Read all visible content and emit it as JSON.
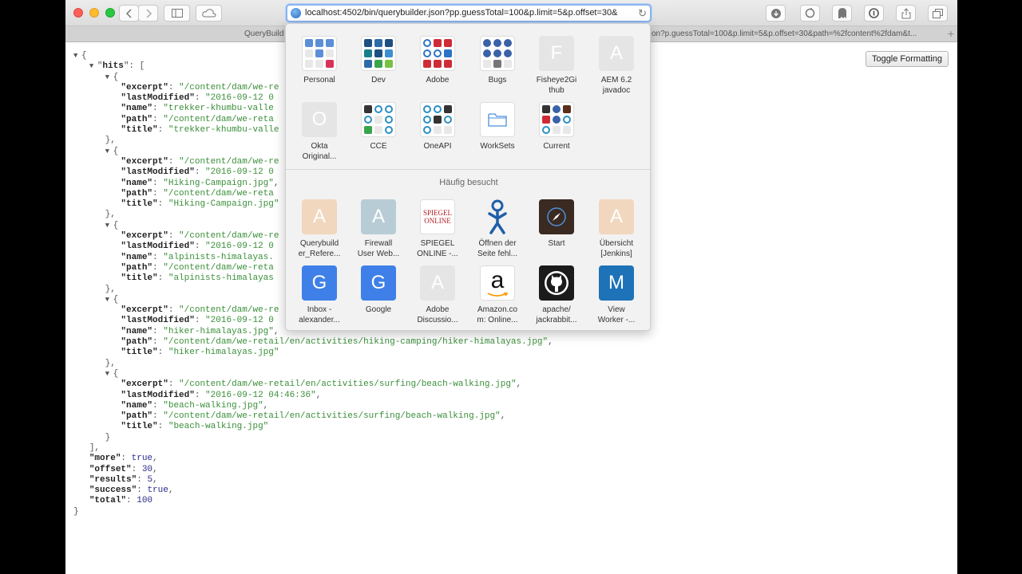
{
  "browser": {
    "url": "localhost:4502/bin/querybuilder.json?pp.guessTotal=100&p.limit=5&p.offset=30&",
    "tabs": [
      {
        "label": "QueryBuild"
      },
      {
        "label": "on?p.guessTotal=100&p.limit=5&p.offset=30&path=%2fcontent%2fdam&t..."
      }
    ],
    "toggle_button": "Toggle Formatting"
  },
  "favorites": [
    {
      "label": "Personal",
      "icon": "personal-folder-icon"
    },
    {
      "label": "Dev",
      "icon": "dev-folder-icon"
    },
    {
      "label": "Adobe",
      "icon": "adobe-folder-icon"
    },
    {
      "label": "Bugs",
      "icon": "bugs-folder-icon"
    },
    {
      "label": "Fisheye2Gi\nthub",
      "letter": "F"
    },
    {
      "label": "AEM 6.2\njavadoc",
      "letter": "A"
    },
    {
      "label": "Okta\nOriginal...",
      "letter": "O"
    },
    {
      "label": "CCE",
      "icon": "cce-folder-icon"
    },
    {
      "label": "OneAPI",
      "icon": "oneapi-folder-icon"
    },
    {
      "label": "WorkSets",
      "icon": "folder-icon"
    },
    {
      "label": "Current",
      "icon": "current-folder-icon"
    }
  ],
  "frequent_heading": "Häufig besucht",
  "frequent": [
    {
      "label": "Querybuild\ner_Refere...",
      "letter": "A"
    },
    {
      "label": "Firewall\nUser Web...",
      "letter": "A"
    },
    {
      "label": "SPIEGEL\nONLINE -...",
      "logo_text": "SPIEGEL ONLINE"
    },
    {
      "label": "Öffnen der\nSeite fehl...",
      "icon": "jenkins-icon"
    },
    {
      "label": "Start",
      "icon": "compass-icon"
    },
    {
      "label": "Übersicht\n[Jenkins]",
      "letter": "A"
    },
    {
      "label": "Inbox -\nalexander...",
      "letter": "G"
    },
    {
      "label": "Google",
      "letter": "G"
    },
    {
      "label": "Adobe\nDiscussio...",
      "letter": "A"
    },
    {
      "label": "Amazon.co\nm: Online...",
      "letter": "a"
    },
    {
      "label": "apache/\njackrabbit...",
      "icon": "github-icon"
    },
    {
      "label": "View\nWorker -...",
      "letter": "M"
    }
  ],
  "json_response": {
    "hits_key": "hits",
    "hits": [
      {
        "excerpt": "/content/dam/we-re",
        "lastModified": "2016-09-12 0",
        "name": "trekker-khumbu-valle",
        "path": "/content/dam/we-reta",
        "title": "trekker-khumbu-valle"
      },
      {
        "excerpt": "/content/dam/we-re",
        "lastModified": "2016-09-12 0",
        "name": "Hiking-Campaign.jpg",
        "path": "/content/dam/we-reta",
        "title": "Hiking-Campaign.jpg"
      },
      {
        "excerpt": "/content/dam/we-re",
        "lastModified": "2016-09-12 0",
        "name": "alpinists-himalayas.",
        "path": "/content/dam/we-reta",
        "title": "alpinists-himalayas"
      },
      {
        "excerpt": "/content/dam/we-re",
        "lastModified": "2016-09-12 0",
        "name": "hiker-himalayas.jpg",
        "path": "/content/dam/we-retail/en/activities/hiking-camping/hiker-himalayas.jpg",
        "title": "hiker-himalayas.jpg"
      },
      {
        "excerpt": "/content/dam/we-retail/en/activities/surfing/beach-walking.jpg",
        "lastModified": "2016-09-12 04:46:36",
        "name": "beach-walking.jpg",
        "path": "/content/dam/we-retail/en/activities/surfing/beach-walking.jpg",
        "title": "beach-walking.jpg"
      }
    ],
    "more": "true",
    "offset": "30",
    "results": "5",
    "success": "true",
    "total": "100"
  }
}
